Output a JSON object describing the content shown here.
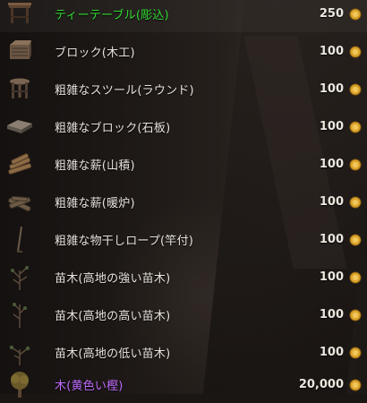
{
  "colors": {
    "green_name": "#33dd33",
    "white_name": "#e8e3dc",
    "purple_name": "#c06bff",
    "coin_gold": "#d9a22a"
  },
  "items": [
    {
      "name": "ティーテーブル(彫込)",
      "price": "250",
      "color": "green_name",
      "icon": "carved-tea-table-icon"
    },
    {
      "name": "ブロック(木工)",
      "price": "100",
      "color": "white_name",
      "icon": "woodwork-block-icon"
    },
    {
      "name": "粗雑なスツール(ラウンド)",
      "price": "100",
      "color": "white_name",
      "icon": "round-stool-icon"
    },
    {
      "name": "粗雑なブロック(石板)",
      "price": "100",
      "color": "white_name",
      "icon": "stone-slab-block-icon"
    },
    {
      "name": "粗雑な薪(山積)",
      "price": "100",
      "color": "white_name",
      "icon": "piled-firewood-icon"
    },
    {
      "name": "粗雑な薪(暖炉)",
      "price": "100",
      "color": "white_name",
      "icon": "fireplace-firewood-icon"
    },
    {
      "name": "粗雑な物干しロープ(竿付)",
      "price": "100",
      "color": "white_name",
      "icon": "clothesline-pole-icon"
    },
    {
      "name": "苗木(高地の強い苗木)",
      "price": "100",
      "color": "white_name",
      "icon": "sapling-strong-icon"
    },
    {
      "name": "苗木(高地の高い苗木)",
      "price": "100",
      "color": "white_name",
      "icon": "sapling-tall-icon"
    },
    {
      "name": "苗木(高地の低い苗木)",
      "price": "100",
      "color": "white_name",
      "icon": "sapling-low-icon"
    },
    {
      "name": "木(黄色い樫)",
      "price": "20,000",
      "color": "purple_name",
      "icon": "yellow-oak-tree-icon"
    }
  ]
}
